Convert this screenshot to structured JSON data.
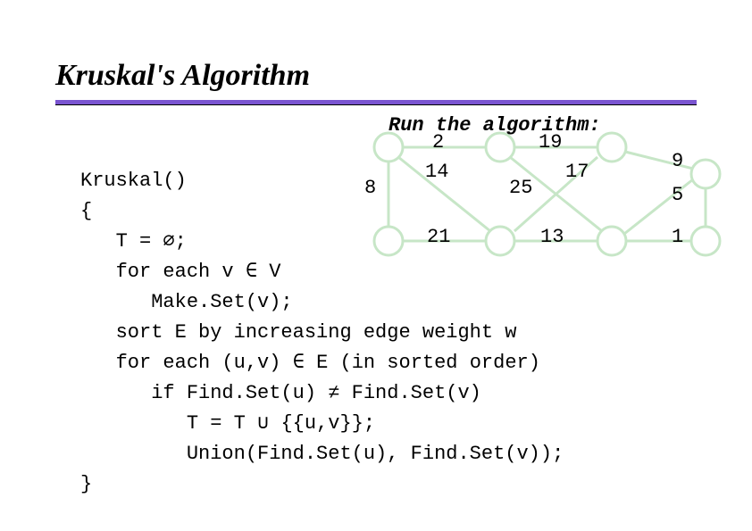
{
  "title": "Kruskal's Algorithm",
  "run_label": "Run the algorithm:",
  "code": {
    "l1": "Kruskal()",
    "l2": "{",
    "l3": "   T = ∅;",
    "l4": "   for each v ∈ V",
    "l5": "      Make.Set(v);",
    "l6": "   sort E by increasing edge weight w",
    "l7": "   for each (u,v) ∈ E (in sorted order)",
    "l8": "      if Find.Set(u) ≠ Find.Set(v)",
    "l9": "         T = T ∪ {{u,v}};",
    "l10": "         Union(Find.Set(u), Find.Set(v));",
    "l11": "}"
  },
  "graph": {
    "weights": {
      "w_top1": "2",
      "w_top2": "19",
      "w_left": "8",
      "w_mid1": "14",
      "w_mid2": "25",
      "w_mid3": "17",
      "w_right_top": "9",
      "w_right_mid": "5",
      "w_bot1": "21",
      "w_bot2": "13",
      "w_right_bot": "1"
    }
  }
}
